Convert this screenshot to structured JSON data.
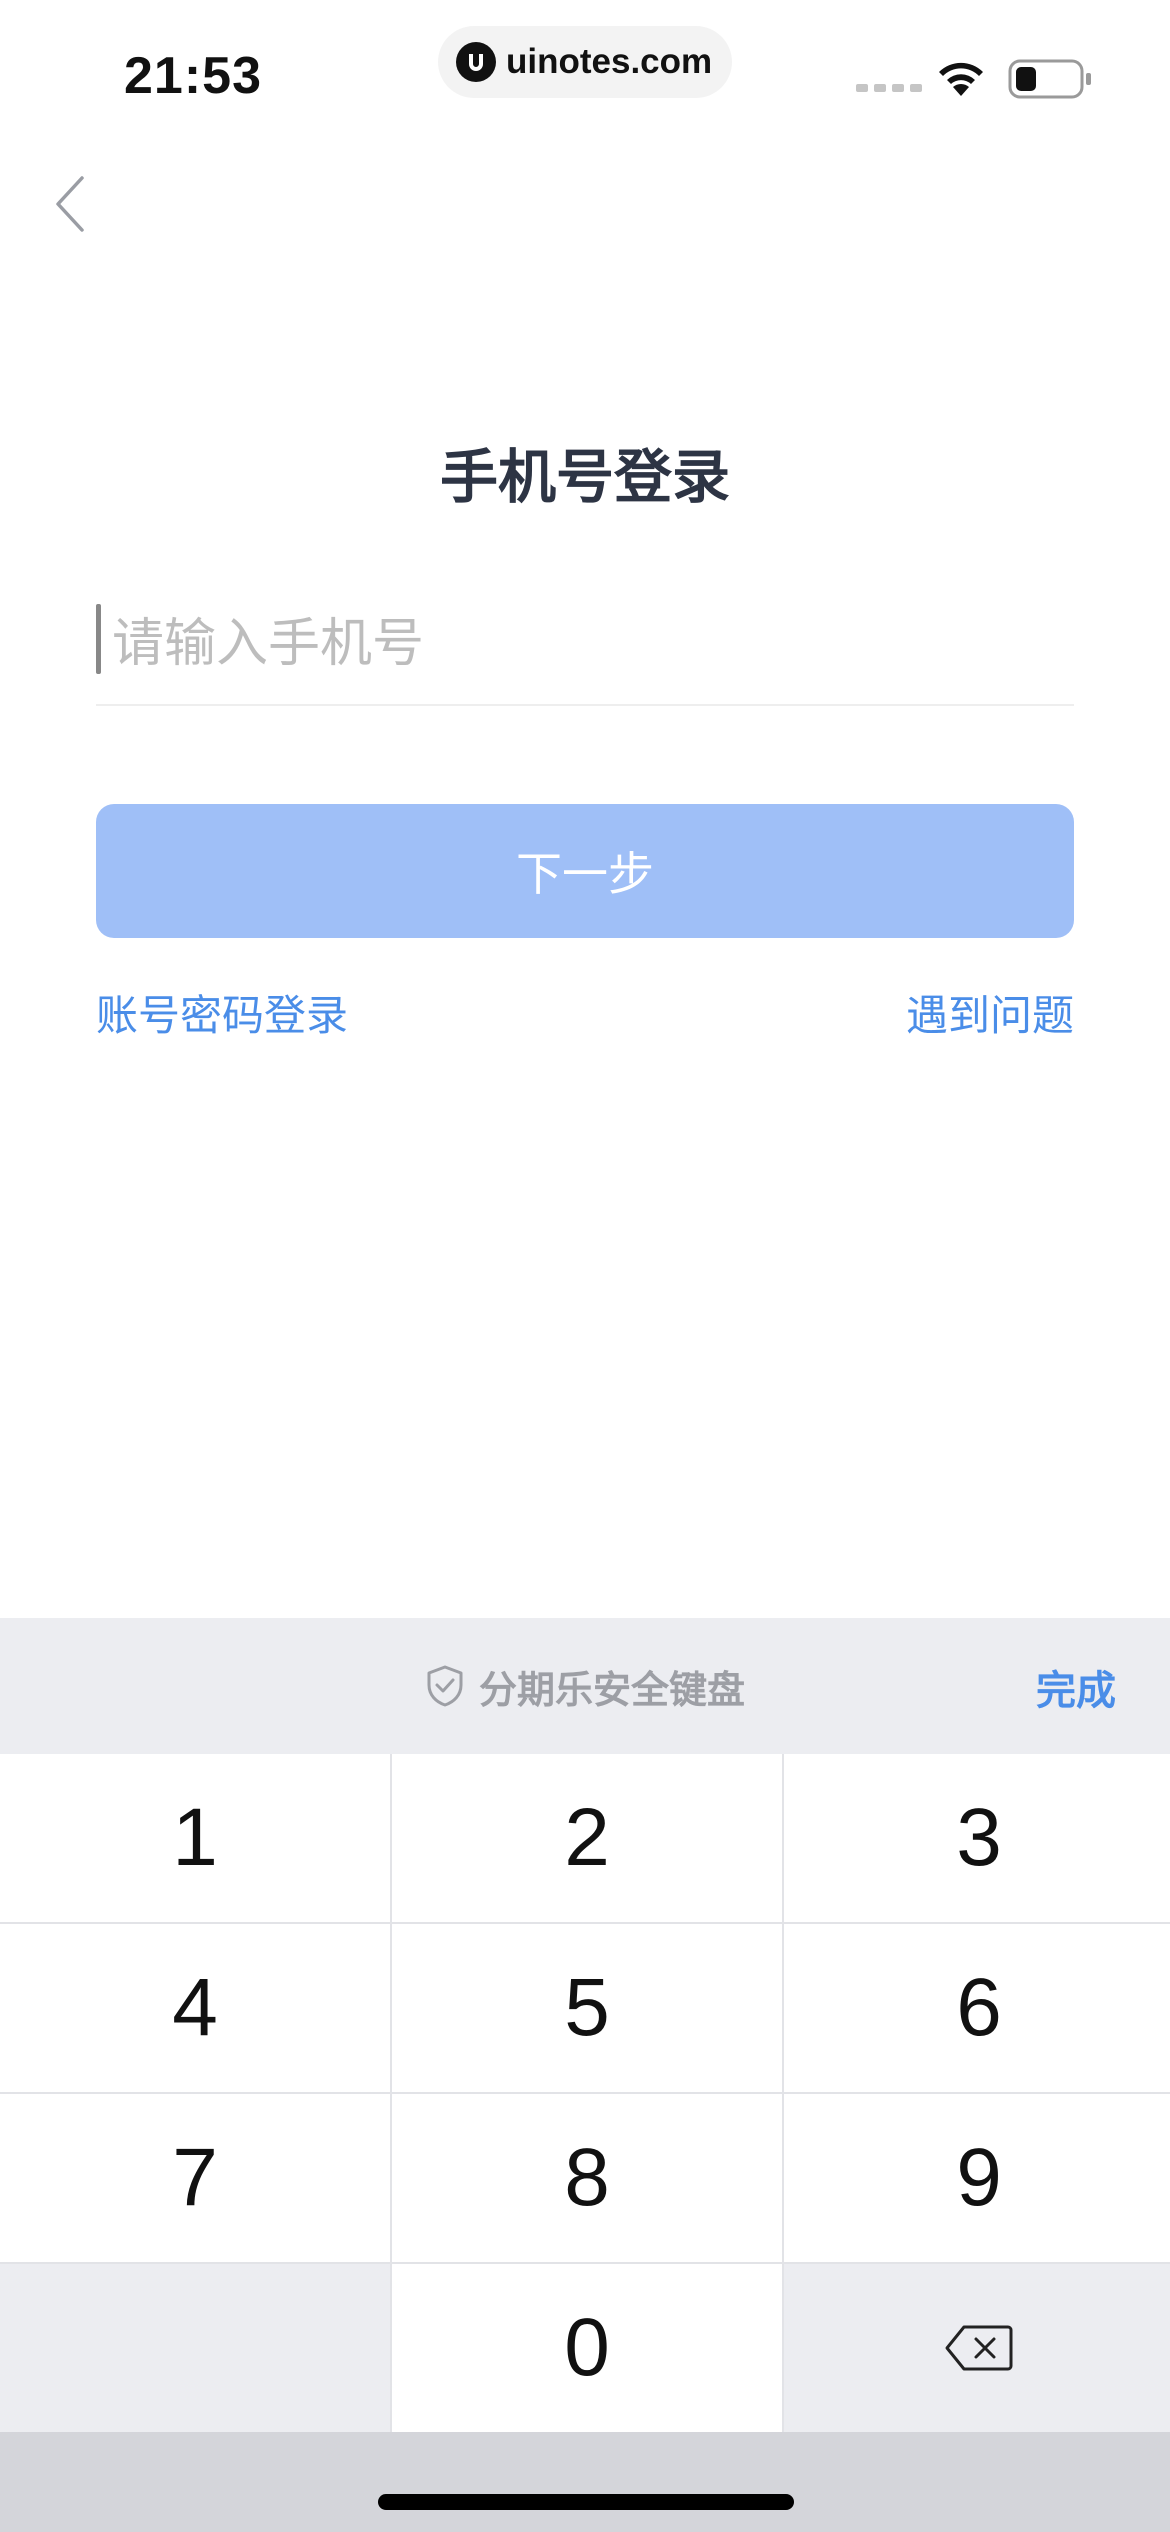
{
  "status_bar": {
    "time": "21:53",
    "url": "uinotes.com"
  },
  "login": {
    "title": "手机号登录",
    "phone_placeholder": "请输入手机号",
    "next_label": "下一步",
    "password_login_label": "账号密码登录",
    "help_label": "遇到问题"
  },
  "keyboard": {
    "brand": "分期乐安全键盘",
    "done_label": "完成",
    "keys": [
      "1",
      "2",
      "3",
      "4",
      "5",
      "6",
      "7",
      "8",
      "9",
      "0"
    ]
  },
  "colors": {
    "accent": "#4a8de8",
    "button_disabled": "#9fbff7",
    "title": "#2d3444"
  }
}
